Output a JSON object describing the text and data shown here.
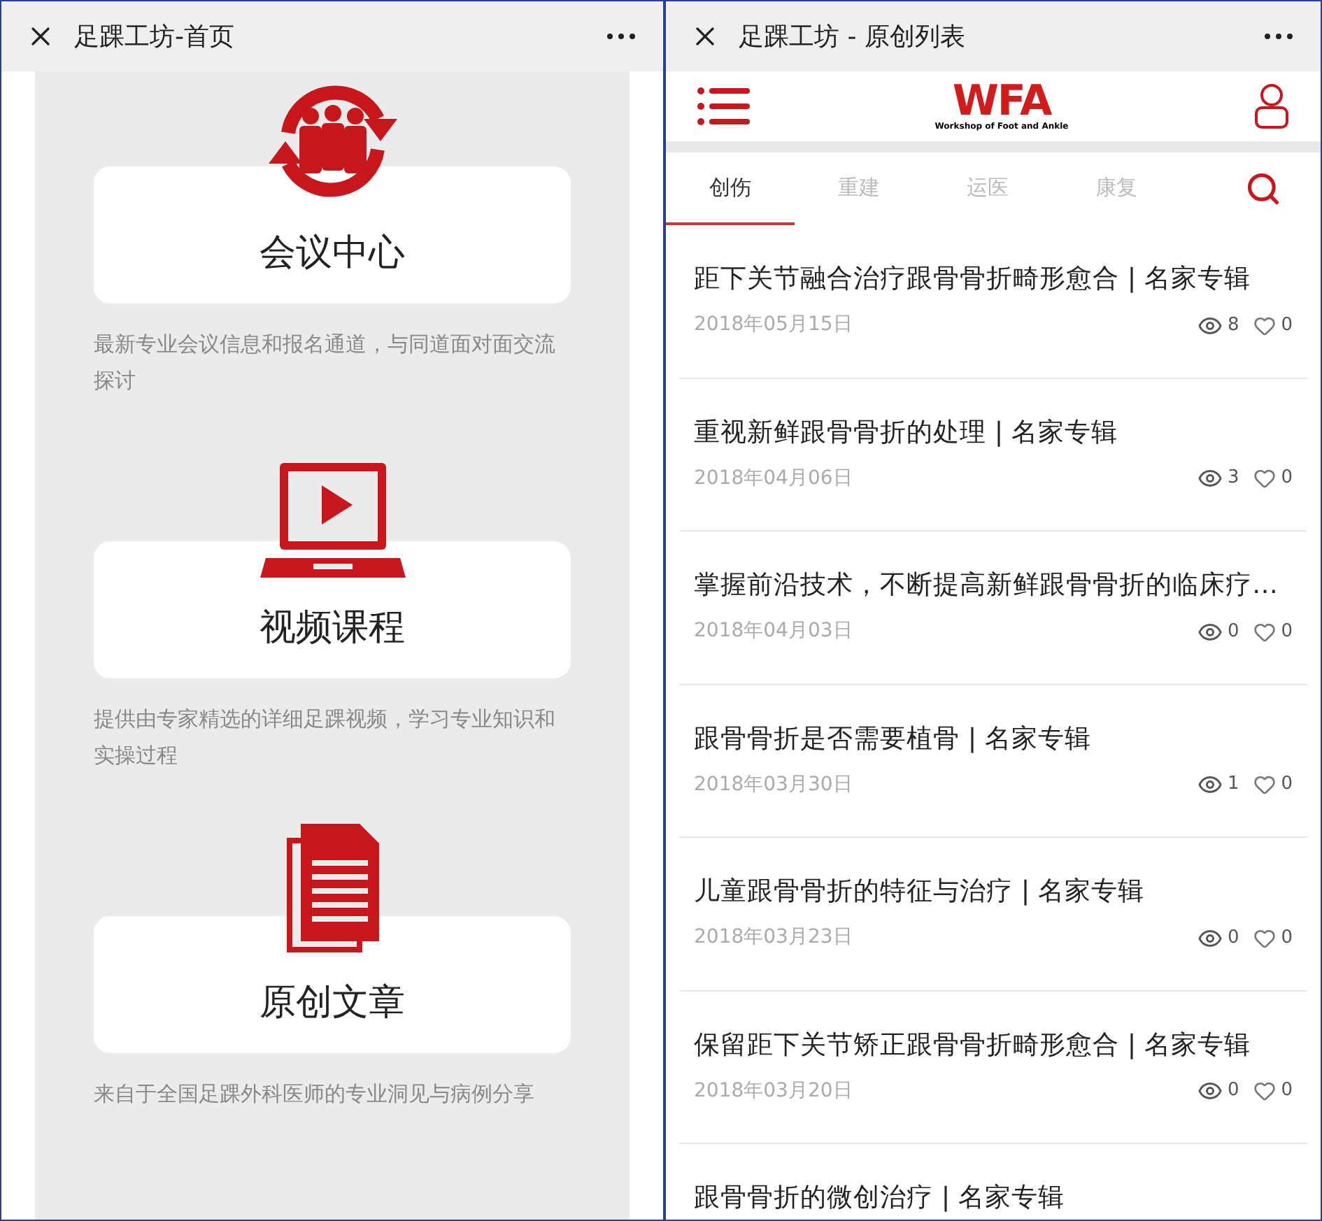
{
  "left_window": {
    "title": "足踝工坊-首页",
    "sections": [
      {
        "kind": "meeting",
        "title": "会议中心",
        "description": "最新专业会议信息和报名通道，与同道面对面交流探讨"
      },
      {
        "kind": "video",
        "title": "视频课程",
        "description": "提供由专家精选的详细足踝视频，学习专业知识和实操过程"
      },
      {
        "kind": "article",
        "title": "原创文章",
        "description": "来自于全国足踝外科医师的专业洞见与病例分享"
      }
    ]
  },
  "right_window": {
    "title": "足踝工坊 - 原创列表",
    "logo": {
      "mark": "WFA",
      "subtitle": "Workshop of Foot and Ankle"
    },
    "tabs": [
      {
        "label": "创伤",
        "selected": true
      },
      {
        "label": "重建",
        "selected": false
      },
      {
        "label": "运医",
        "selected": false
      },
      {
        "label": "康复",
        "selected": false
      }
    ],
    "articles": [
      {
        "title": "距下关节融合治疗跟骨骨折畸形愈合 | 名家专辑",
        "date": "2018年05月15日",
        "views": "8",
        "likes": "0"
      },
      {
        "title": "重视新鲜跟骨骨折的处理 | 名家专辑",
        "date": "2018年04月06日",
        "views": "3",
        "likes": "0"
      },
      {
        "title": "掌握前沿技术，不断提高新鲜跟骨骨折的临床疗…",
        "date": "2018年04月03日",
        "views": "0",
        "likes": "0"
      },
      {
        "title": "跟骨骨折是否需要植骨 | 名家专辑",
        "date": "2018年03月30日",
        "views": "1",
        "likes": "0"
      },
      {
        "title": "儿童跟骨骨折的特征与治疗 | 名家专辑",
        "date": "2018年03月23日",
        "views": "0",
        "likes": "0"
      },
      {
        "title": "保留距下关节矫正跟骨骨折畸形愈合 | 名家专辑",
        "date": "2018年03月20日",
        "views": "0",
        "likes": "0"
      },
      {
        "title": "跟骨骨折的微创治疗 | 名家专辑"
      }
    ]
  }
}
